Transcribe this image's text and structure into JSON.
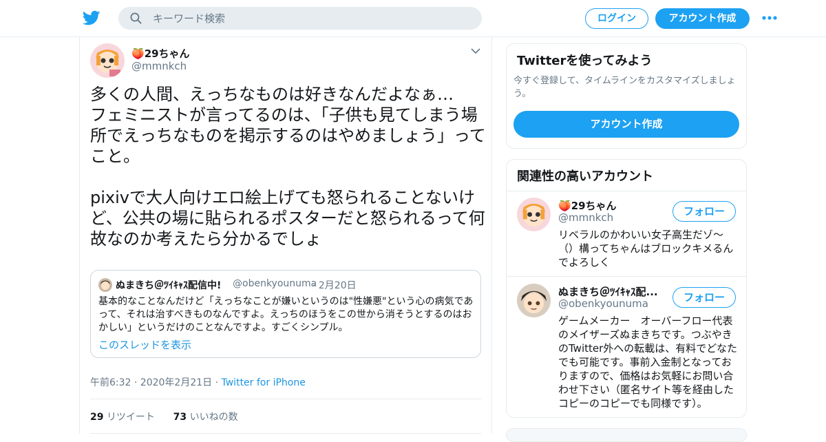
{
  "header": {
    "search_placeholder": "キーワード検索",
    "login_label": "ログイン",
    "signup_label": "アカウント作成"
  },
  "tweet": {
    "author_emoji": "🍑",
    "author_name": "29ちゃん",
    "author_handle": "@mmnkch",
    "text": "多くの人間、えっちなものは好きなんだよなぁ…\nフェミニストが言ってるのは、「子供も見てしまう場所でえっちなものを掲示するのはやめましょう」ってこと。\n\npixivで大人向けエロ絵上げても怒られることないけど、公共の場に貼られるポスターだと怒られるって何故なのか考えたら分かるでしょ",
    "quote": {
      "name": "ぬまきち＠ﾂｲｷｬｽ配信中!",
      "handle": "@obenkyounuma",
      "date": "· 2月20日",
      "text": "基本的なことなんだけど「えっちなことが嫌いというのは\"性嫌悪\"という心の病気であって、それは治すべきものなんですよ。えっちのほうをこの世から消そうとするのはおかしい」というだけのことなんですよ。すごくシンプル。",
      "thread_link": "このスレッドを表示"
    },
    "meta_time": "午前6:32 · 2020年2月21日 · ",
    "meta_source": "Twitter for iPhone",
    "retweets_count": "29",
    "retweets_label": "リツイート",
    "likes_count": "73",
    "likes_label": "いいねの数"
  },
  "sidebar": {
    "try_title": "Twitterを使ってみよう",
    "try_desc": "今すぐ登録して、タイムラインをカスタマイズしましょう。",
    "try_cta": "アカウント作成",
    "related_title": "関連性の高いアカウント",
    "accounts": [
      {
        "emoji": "🍑",
        "name": "29ちゃん",
        "handle": "@mmnkch",
        "follow_label": "フォロー",
        "bio": "リベラルのかわいい女子高生だゾ〜（）構ってちゃんはブロックキメるんでよろしく"
      },
      {
        "emoji": "",
        "name": "ぬまきち＠ﾂｲｷｬｽ配...",
        "handle": "@obenkyounuma",
        "follow_label": "フォロー",
        "bio": "ゲームメーカー　オーバーフロー代表のメイザーズぬまきちです。つぶやきのTwitter外への転載は、有料でどなたでも可能です。事前入金制となっておりますので、価格はお気軽にお問い合わせ下さい（匿名サイト等を経由したコピーのコピーでも同様です）。"
      }
    ]
  },
  "colors": {
    "brand": "#1da1f2",
    "link": "#1b95e0",
    "muted": "#657786",
    "border": "#e6ecf0"
  },
  "icons": [
    "twitter-logo-icon",
    "search-icon",
    "more-icon",
    "chevron-down-icon"
  ]
}
